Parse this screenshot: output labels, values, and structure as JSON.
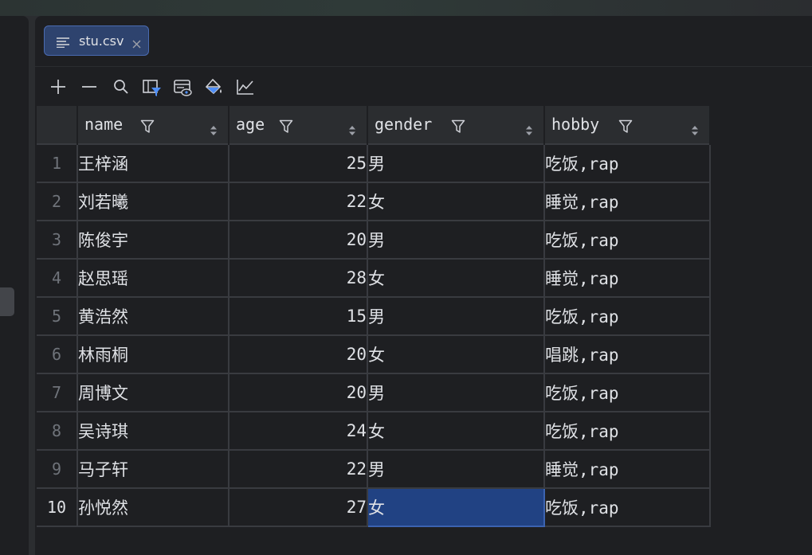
{
  "tab": {
    "label": "stu.csv"
  },
  "toolbar": {
    "tools": [
      "add-row-icon",
      "remove-row-icon",
      "search-icon",
      "filter-view-icon",
      "preview-icon",
      "color-fill-icon",
      "chart-icon"
    ]
  },
  "table": {
    "columns": [
      {
        "label": "name"
      },
      {
        "label": "age"
      },
      {
        "label": "gender"
      },
      {
        "label": "hobby"
      }
    ],
    "rows": [
      {
        "num": "1",
        "name": "王梓涵",
        "age": "25",
        "gender": "男",
        "hobby": "吃饭,rap"
      },
      {
        "num": "2",
        "name": "刘若曦",
        "age": "22",
        "gender": "女",
        "hobby": "睡觉,rap"
      },
      {
        "num": "3",
        "name": "陈俊宇",
        "age": "20",
        "gender": "男",
        "hobby": "吃饭,rap"
      },
      {
        "num": "4",
        "name": "赵思瑶",
        "age": "28",
        "gender": "女",
        "hobby": "睡觉,rap"
      },
      {
        "num": "5",
        "name": "黄浩然",
        "age": "15",
        "gender": "男",
        "hobby": "吃饭,rap"
      },
      {
        "num": "6",
        "name": "林雨桐",
        "age": "20",
        "gender": "女",
        "hobby": "唱跳,rap"
      },
      {
        "num": "7",
        "name": "周博文",
        "age": "20",
        "gender": "男",
        "hobby": "吃饭,rap"
      },
      {
        "num": "8",
        "name": "吴诗琪",
        "age": "24",
        "gender": "女",
        "hobby": "吃饭,rap"
      },
      {
        "num": "9",
        "name": "马子轩",
        "age": "22",
        "gender": "男",
        "hobby": "睡觉,rap"
      },
      {
        "num": "10",
        "name": "孙悦然",
        "age": "27",
        "gender": "女",
        "hobby": "吃饭,rap"
      }
    ]
  },
  "colors": {
    "background": "#1e1f22",
    "header_bg": "#2b2d30",
    "grid_line": "#393b40",
    "selection": "#214283",
    "tab_bg": "#2e436e"
  }
}
